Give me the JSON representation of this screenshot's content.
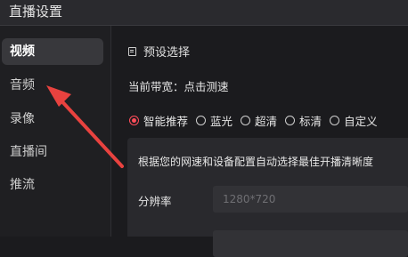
{
  "window": {
    "title": "直播设置"
  },
  "sidebar": {
    "items": [
      {
        "label": "视频",
        "active": true
      },
      {
        "label": "音频",
        "active": false
      },
      {
        "label": "录像",
        "active": false
      },
      {
        "label": "直播间",
        "active": false
      },
      {
        "label": "推流",
        "active": false
      }
    ]
  },
  "main": {
    "section_title": "预设选择",
    "bandwidth_label": "当前带宽：",
    "bandwidth_link": "点击测速",
    "presets": [
      {
        "label": "智能推荐",
        "selected": true
      },
      {
        "label": "蓝光",
        "selected": false
      },
      {
        "label": "超清",
        "selected": false
      },
      {
        "label": "标清",
        "selected": false
      },
      {
        "label": "自定义",
        "selected": false
      }
    ],
    "panel": {
      "description": "根据您的网速和设备配置自动选择最佳开播清晰度",
      "resolution_label": "分辨率",
      "resolution_value": "1280*720"
    }
  },
  "colors": {
    "accent": "#ff4d5a",
    "background": "#1b1b1e",
    "annotation_arrow": "#e8423f"
  }
}
